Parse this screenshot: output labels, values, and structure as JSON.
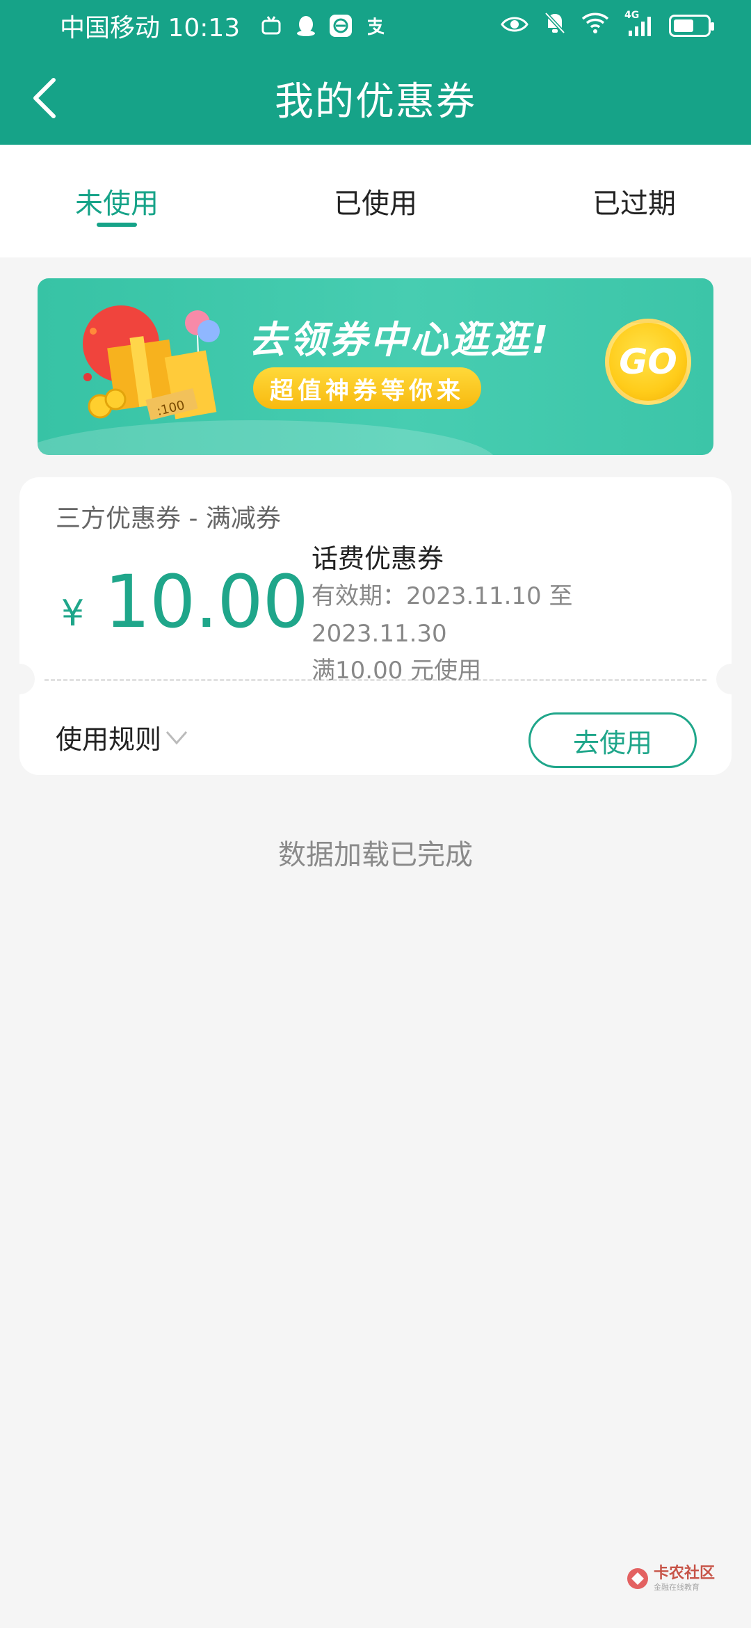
{
  "status_bar": {
    "carrier_time": "中国移动 10:13",
    "icons": [
      "tv-icon",
      "qq-icon",
      "app-icon",
      "alipay-icon"
    ],
    "right_icons": [
      "eye-icon",
      "bell-off-icon",
      "wifi-icon",
      "signal-4g-icon",
      "battery-icon"
    ],
    "network": "4G"
  },
  "header": {
    "title": "我的优惠券"
  },
  "tabs": [
    {
      "label": "未使用",
      "active": true
    },
    {
      "label": "已使用",
      "active": false
    },
    {
      "label": "已过期",
      "active": false
    }
  ],
  "banner": {
    "title": "去领券中心逛逛!",
    "subtitle": "超值神券等你来",
    "go_label": "GO",
    "gift_tag": ":100"
  },
  "coupon": {
    "category": "三方优惠券 - 满减券",
    "currency": "¥",
    "amount": "10.00",
    "name": "话费优惠券",
    "validity": "有效期：2023.11.10 至 2023.11.30",
    "condition": "满10.00 元使用",
    "rules_label": "使用规则",
    "use_label": "去使用"
  },
  "footer": {
    "loaded_text": "数据加载已完成"
  },
  "watermark": {
    "name": "卡农社区",
    "sub": "金融在线教育"
  },
  "colors": {
    "primary": "#16a388",
    "accent_green": "#1fa68a",
    "banner_green": "#3cc5a8",
    "go_yellow": "#ffcc1a"
  }
}
